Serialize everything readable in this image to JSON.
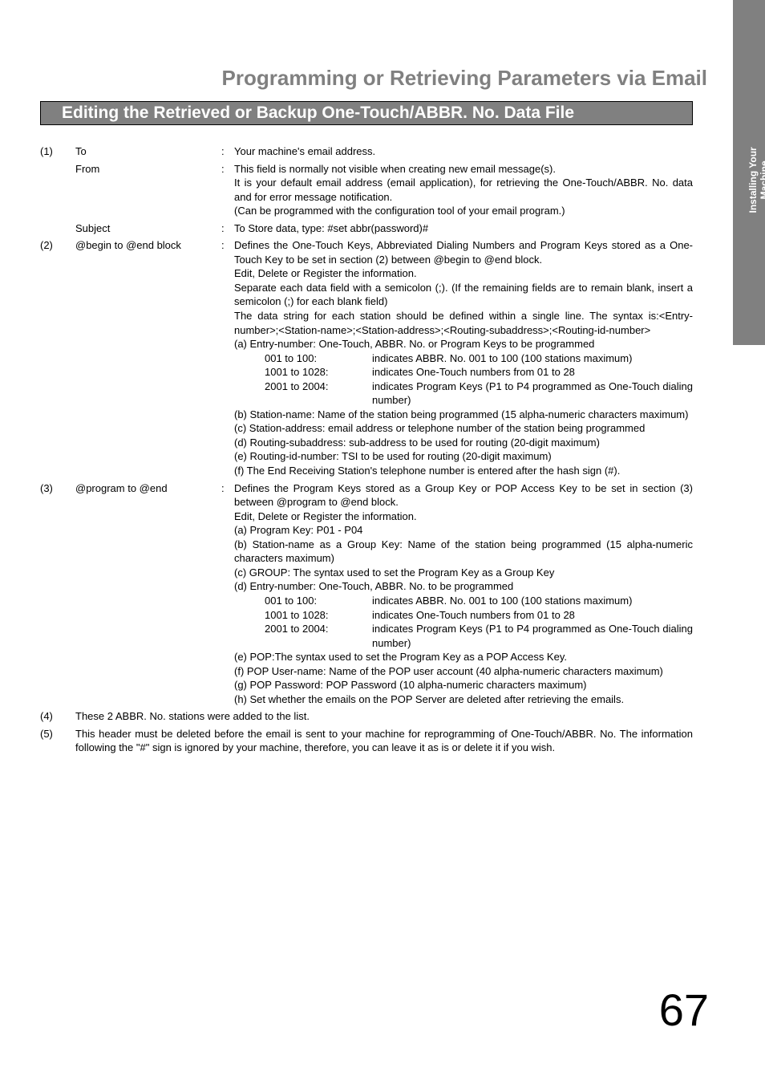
{
  "sideTab": {
    "line1": "Installing Your",
    "line2": "Machine"
  },
  "pageTitle": "Programming or Retrieving Parameters via Email",
  "sectionBar": "Editing the Retrieved or Backup One-Touch/ABBR. No. Data File",
  "pageNumber": "67",
  "item1": {
    "idx": "(1)",
    "to": {
      "label": "To",
      "text": "Your machine's email address."
    },
    "from": {
      "label": "From",
      "p1": "This field is normally not visible when creating new email message(s).",
      "p2": "It is your default email address (email application), for retrieving the One-Touch/ABBR. No. data and for error message notification.",
      "p3": "(Can be programmed with the configuration tool of your email program.)"
    },
    "subject": {
      "label": "Subject",
      "text": "To Store data, type: #set abbr(password)#"
    }
  },
  "item2": {
    "idx": "(2)",
    "label": "@begin to @end block",
    "p1": "Defines the One-Touch Keys, Abbreviated Dialing Numbers and Program Keys stored as a One-Touch Key to be set in section (2) between @begin to @end block.",
    "p2": "Edit, Delete or Register the information.",
    "p3": "Separate each data field with a semicolon (;). (If the remaining fields are to remain blank, insert a semicolon (;) for each blank field)",
    "p4": "The data string for each station should be defined within a single line.  The syntax is:<Entry-number>;<Station-name>;<Station-address>;<Routing-subaddress>;<Routing-id-number>",
    "a": "(a) Entry-number:  One-Touch, ABBR. No. or Program Keys to be programmed",
    "r1": {
      "lab": "001 to 100:",
      "val": "indicates ABBR. No. 001 to 100 (100 stations maximum)"
    },
    "r2": {
      "lab": "1001 to 1028:",
      "val": "indicates One-Touch numbers from 01 to 28"
    },
    "r3": {
      "lab": "2001 to 2004:",
      "val": "indicates Program Keys (P1 to P4 programmed as One-Touch dialing number)"
    },
    "b": "(b) Station-name:  Name of the station being programmed (15 alpha-numeric characters maximum)",
    "c": "(c) Station-address:  email address or telephone number of the station being programmed",
    "d": "(d) Routing-subaddress:  sub-address to be used for routing (20-digit maximum)",
    "e": "(e) Routing-id-number:  TSI to be used for routing (20-digit maximum)",
    "f": "(f) The End Receiving Station's telephone number is entered after the hash sign (#)."
  },
  "item3": {
    "idx": "(3)",
    "label": "@program to @end",
    "p1": "Defines the Program Keys stored as a Group Key or POP Access Key to be set in section (3) between @program to @end block.",
    "p2": "Edit, Delete or Register the information.",
    "a": "(a) Program Key: P01 - P04",
    "b": "(b) Station-name as a Group Key: Name of the station being programmed (15 alpha-numeric characters maximum)",
    "c": "(c) GROUP: The syntax used to set the Program Key as a Group Key",
    "d": "(d) Entry-number: One-Touch, ABBR. No. to be programmed",
    "r1": {
      "lab": "001 to 100:",
      "val": "indicates ABBR. No. 001 to 100 (100 stations maximum)"
    },
    "r2": {
      "lab": "1001 to 1028:",
      "val": "indicates One-Touch numbers from 01 to 28"
    },
    "r3": {
      "lab": "2001 to 2004:",
      "val": "indicates Program Keys (P1 to P4 programmed as One-Touch dialing number)"
    },
    "e": "(e) POP:The syntax used to set the Program Key as a POP Access Key.",
    "f": "(f) POP User-name: Name of the POP user account (40 alpha-numeric characters maximum)",
    "g": "(g) POP Password: POP Password (10 alpha-numeric characters maximum)",
    "h": "(h) Set whether the emails on the POP Server are deleted after retrieving the emails."
  },
  "item4": {
    "idx": "(4)",
    "text": "These 2 ABBR. No. stations were added to the list."
  },
  "item5": {
    "idx": "(5)",
    "text": "This header must be deleted before the email is sent to your machine for reprogramming of One-Touch/ABBR. No. The information following the \"#\" sign is ignored by your machine, therefore, you can leave it as is or delete it if you wish."
  }
}
